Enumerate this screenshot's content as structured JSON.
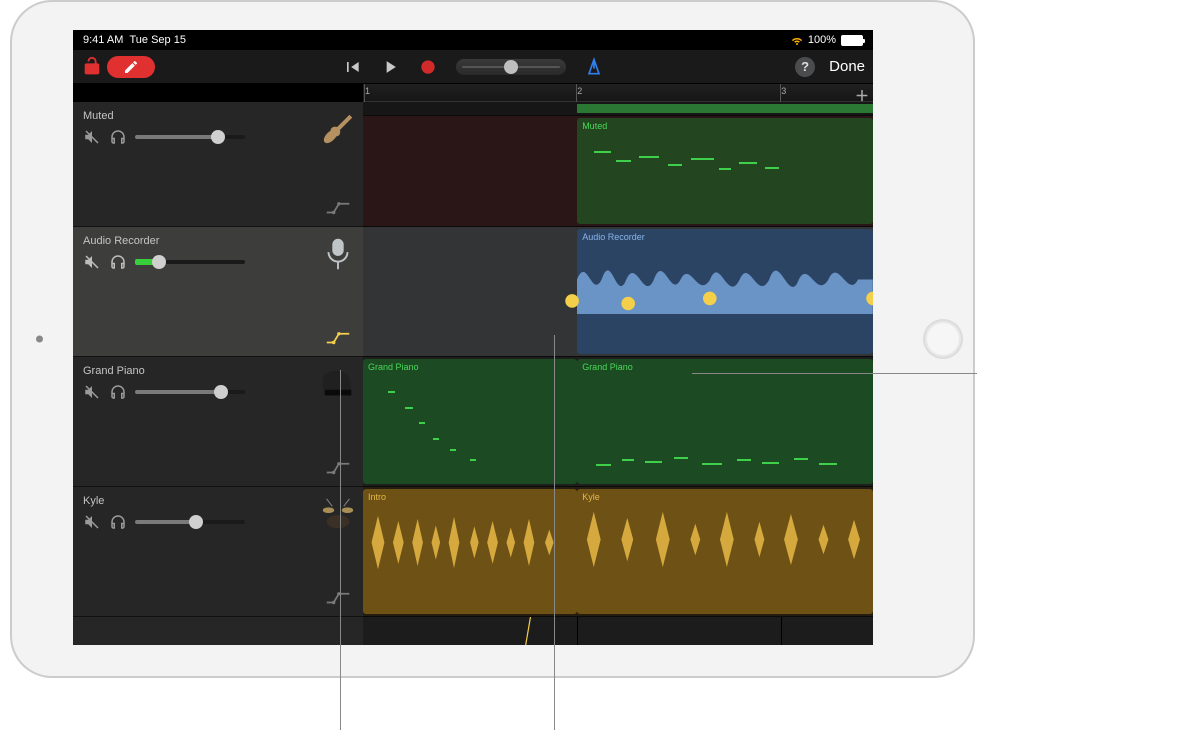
{
  "status": {
    "time": "9:41 AM",
    "date": "Tue Sep 15",
    "battery_pct": "100%"
  },
  "toolbar": {
    "done_label": "Done"
  },
  "ruler": {
    "marks": [
      "1",
      "2",
      "3"
    ]
  },
  "tracks": [
    {
      "id": "muted-guitar",
      "name": "Muted",
      "instrument": "guitar",
      "volume": 0.75,
      "selected": false,
      "automation_on": false,
      "regions": [
        {
          "label": "Muted",
          "start": 0.42,
          "end": 1.0,
          "color": "green"
        }
      ]
    },
    {
      "id": "audio-recorder",
      "name": "Audio Recorder",
      "instrument": "mic",
      "volume": 0.22,
      "selected": true,
      "automation_on": true,
      "regions": [
        {
          "label": "Audio Recorder",
          "start": 0.42,
          "end": 1.0,
          "color": "blue"
        }
      ]
    },
    {
      "id": "grand-piano",
      "name": "Grand Piano",
      "instrument": "piano",
      "volume": 0.78,
      "selected": false,
      "automation_on": false,
      "regions": [
        {
          "label": "Grand Piano",
          "start": 0.0,
          "end": 0.42,
          "color": "green"
        },
        {
          "label": "Grand Piano",
          "start": 0.42,
          "end": 1.0,
          "color": "green"
        }
      ]
    },
    {
      "id": "kyle-drums",
      "name": "Kyle",
      "instrument": "drums",
      "volume": 0.55,
      "selected": false,
      "automation_on": false,
      "regions": [
        {
          "label": "Intro",
          "start": 0.0,
          "end": 0.42,
          "color": "yellow"
        },
        {
          "label": "Kyle",
          "start": 0.42,
          "end": 1.0,
          "color": "yellow"
        }
      ]
    }
  ],
  "automation_points": [
    {
      "x": 0.0,
      "y": 0.93
    },
    {
      "x": 0.3,
      "y": 0.93
    },
    {
      "x": 0.41,
      "y": 0.29
    },
    {
      "x": 0.52,
      "y": 0.3
    },
    {
      "x": 0.58,
      "y": 0.58
    },
    {
      "x": 0.68,
      "y": 0.28
    },
    {
      "x": 1.0,
      "y": 0.28
    }
  ],
  "colors": {
    "green": "#2f8a3a",
    "blue": "#3a628f",
    "yellow": "#a97e24",
    "automation": "#f4d04a"
  }
}
